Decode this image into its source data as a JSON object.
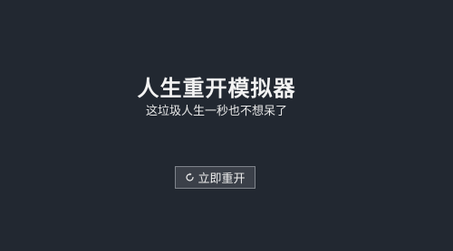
{
  "app": {
    "title": "人生重开模拟器",
    "subtitle": "这垃圾人生一秒也不想呆了"
  },
  "actions": {
    "restart_label": "立即重开",
    "restart_icon": "refresh-icon"
  },
  "colors": {
    "background": "#222831",
    "button_background": "#3b4049",
    "button_border": "#80858c",
    "text": "#ffffff"
  }
}
